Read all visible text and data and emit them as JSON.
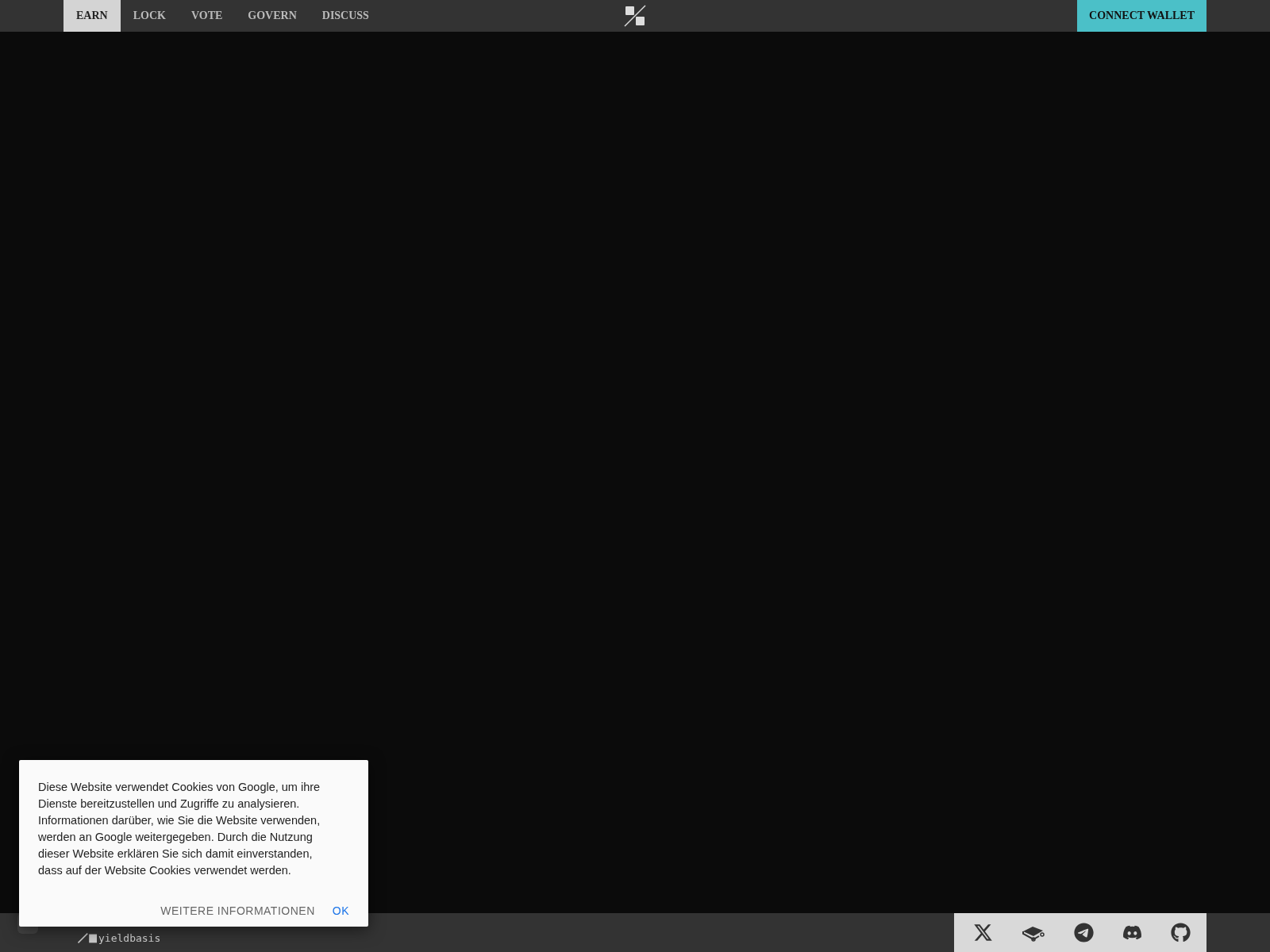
{
  "nav": {
    "tabs": [
      {
        "label": "EARN",
        "selected": true
      },
      {
        "label": "LOCK",
        "selected": false
      },
      {
        "label": "VOTE",
        "selected": false
      },
      {
        "label": "GOVERN",
        "selected": false
      },
      {
        "label": "DISCUSS",
        "selected": false
      }
    ],
    "connect_button": "CONNECT WALLET"
  },
  "footer": {
    "brand": "yieldbasis"
  },
  "cookie_dialog": {
    "text": "Diese Website verwendet Cookies von Google, um ihre Dienste bereitzustellen und Zugriffe zu analysieren. Informationen darüber, wie Sie die Website verwenden, werden an Google weitergegeben. Durch die Nutzung dieser Website erklären Sie sich damit einverstanden, dass auf der Website Cookies verwendet werden.",
    "buttons": [
      "WEITERE INFORMATIONEN",
      "OK"
    ]
  }
}
